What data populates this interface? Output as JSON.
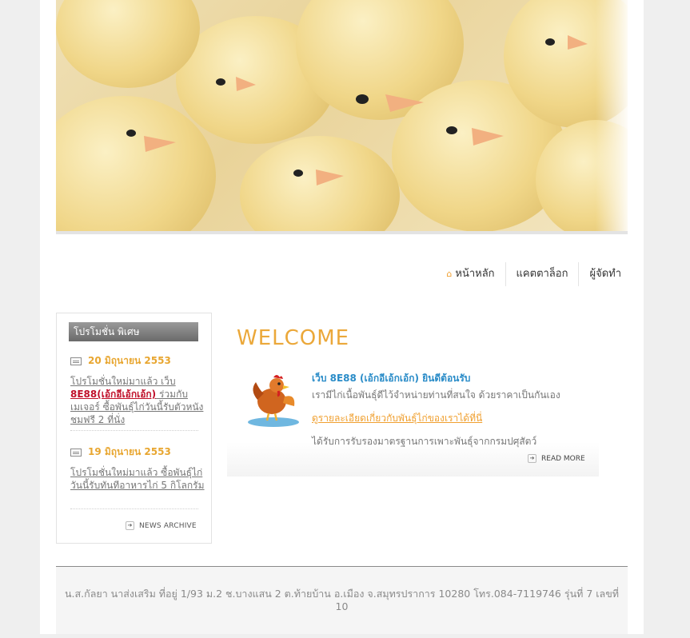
{
  "nav": {
    "items": [
      "หน้าหลัก",
      "แคตตาล็อก",
      "ผู้จัดทำ"
    ]
  },
  "sidebar": {
    "title": "โปรโมชั่น พิเศษ",
    "news": [
      {
        "date": "20 มิถุนายน 2553",
        "text_before": "โปรโมชั่นใหม่มาแล้ว เว็บ ",
        "highlight": "8E88(เอ้กอีเอ้กเอ้ก)",
        "text_after": " ร่วมกับเมเจอร์ ซื้อพันธุ์ไก่วันนี้รับตัวหนังชมฟรี 2 ที่นั่ง"
      },
      {
        "date": "19 มิถุนายน 2553",
        "text_before": "โปรโมชั่นใหม่มาแล้ว ซื้อพันธุ์ไก่วันนี้รับทันทีอาหารไก่ 5 กิโลกรัม",
        "highlight": "",
        "text_after": ""
      }
    ],
    "archive_label": "NEWS ARCHIVE"
  },
  "welcome": {
    "title": "WELCOME",
    "heading": "เว็บ 8E88 (เอ้กอีเอ้กเอ้ก) ยินดีต้อนรับ",
    "line1": "เรามีไก่เนื้อพันธุ์ดีไว้จำหน่ายท่านที่สนใจ ด้วยราคาเป็นกันเอง",
    "link": "ดูรายละเอียดเกี่ยวกับพันธุ์ไก่ของเราได้ที่นี่",
    "line2": "ได้รับการรับรองมาตรฐานการเพาะพันธุ์จากกรมปศุสัตว์",
    "readmore_label": "READ MORE"
  },
  "footer": {
    "text": "น.ส.กัลยา นาส่งเสริม ที่อยู่ 1/93 ม.2 ช.บางแสน 2 ต.ท้ายบ้าน อ.เมือง จ.สมุทรปราการ 10280 โทร.084-7119746 รุ่นที่ 7 เลขที่ 10"
  },
  "colors": {
    "accent": "#eba83a",
    "link_blue": "#2a8cc8",
    "highlight_red": "#c0102a",
    "page_bg": "#efefef"
  },
  "icons": {
    "home": "home-icon",
    "news": "news-icon",
    "arrow": "arrow-right-icon"
  }
}
